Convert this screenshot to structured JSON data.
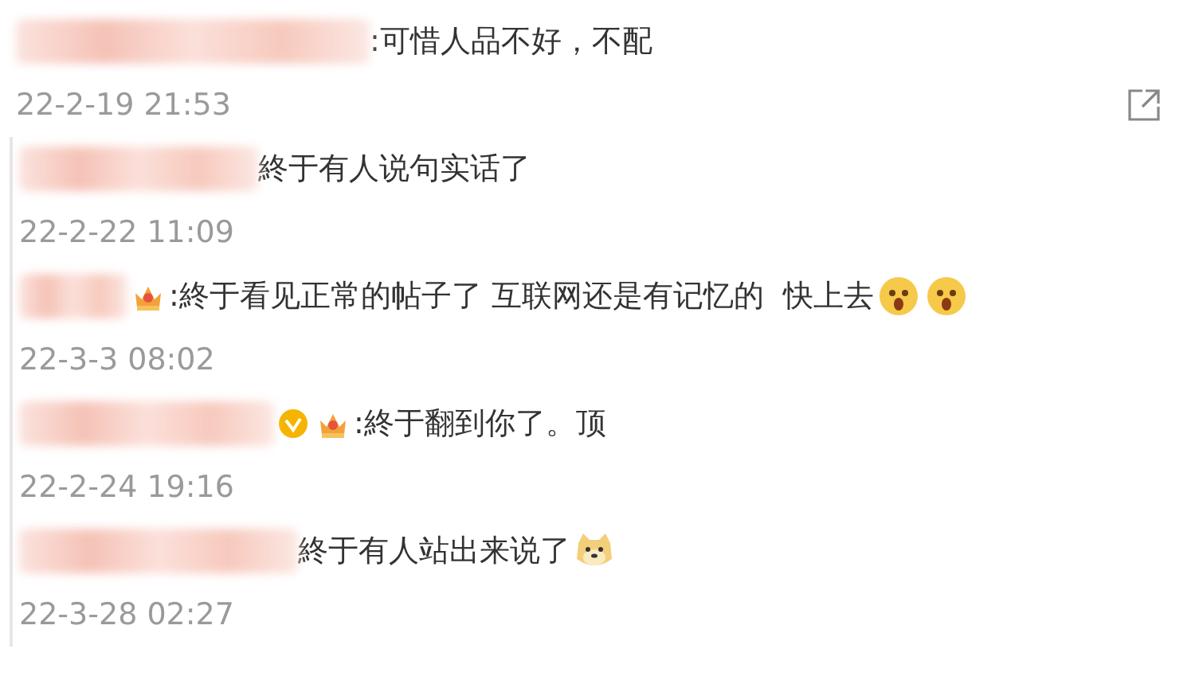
{
  "comments": [
    {
      "reply": false,
      "text": ":可惜人品不好，不配",
      "time": "22-2-19 21:53",
      "share": true
    },
    {
      "reply": true,
      "text": "終于有人说句实话了",
      "time": "22-2-22 11:09",
      "share": false
    },
    {
      "reply": true,
      "badges": [
        {
          "kind": "crown"
        }
      ],
      "text": ":終于看见正常的帖子了 互联网还是有记忆的  快上去",
      "emojis": [
        {
          "kind": "shocked"
        },
        {
          "kind": "shocked"
        }
      ],
      "time": "22-3-3 08:02",
      "share": false
    },
    {
      "reply": true,
      "badges": [
        {
          "kind": "verified"
        },
        {
          "kind": "crown"
        }
      ],
      "text": ":終于翻到你了。顶",
      "time": "22-2-24 19:16",
      "share": false
    },
    {
      "reply": true,
      "text": "終于有人站出来说了",
      "emojis": [
        {
          "kind": "doge"
        }
      ],
      "time": "22-3-28 02:27",
      "share": false
    }
  ]
}
